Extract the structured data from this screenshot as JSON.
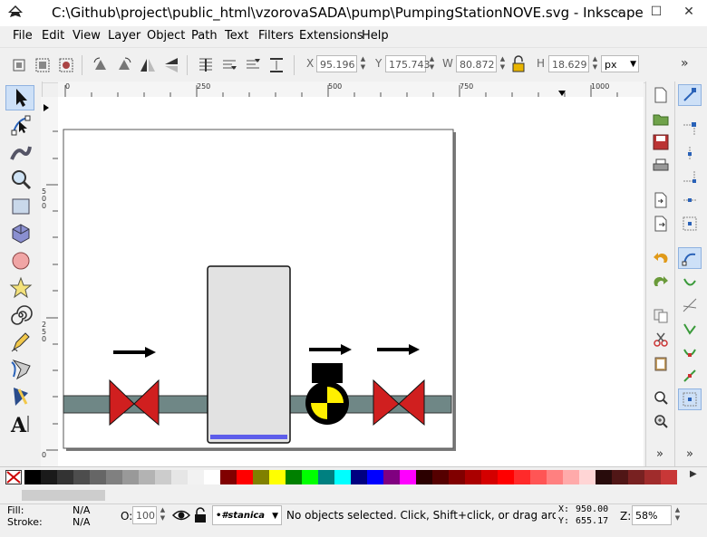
{
  "window": {
    "title": "C:\\Github\\project\\public_html\\vzorovaSADA\\pump\\PumpingStationNOVE.svg - Inkscape",
    "minimize": "–",
    "maximize": "☐",
    "close": "✕"
  },
  "menu": [
    "File",
    "Edit",
    "View",
    "Layer",
    "Object",
    "Path",
    "Text",
    "Filters",
    "Extensions",
    "Help"
  ],
  "toolbar": {
    "x_label": "X",
    "x_value": "95.196",
    "y_label": "Y",
    "y_value": "175.743",
    "w_label": "W",
    "w_value": "80.872",
    "h_label": "H",
    "h_value": "18.629",
    "unit": "px",
    "overflow": "»"
  },
  "ruler": {
    "h_ticks": [
      "0",
      "250",
      "500",
      "750",
      "1000"
    ],
    "v_ticks": [
      "500",
      "250",
      "0"
    ]
  },
  "tools": [
    "selector-tool",
    "node-tool",
    "tweak-tool",
    "zoom-tool",
    "rect-tool",
    "3dbox-tool",
    "ellipse-tool",
    "star-tool",
    "spiral-tool",
    "pencil-tool",
    "pen-tool",
    "calligraphy-tool",
    "text-tool"
  ],
  "palette": [
    "#000000",
    "#1a1a1a",
    "#333333",
    "#4d4d4d",
    "#666666",
    "#808080",
    "#999999",
    "#b3b3b3",
    "#cccccc",
    "#e6e6e6",
    "#f2f2f2",
    "#ffffff",
    "#800000",
    "#ff0000",
    "#808000",
    "#ffff00",
    "#008000",
    "#00ff00",
    "#008080",
    "#00ffff",
    "#000080",
    "#0000ff",
    "#800080",
    "#ff00ff",
    "#2b0000",
    "#550000",
    "#800000",
    "#aa0000",
    "#d40000",
    "#ff0000",
    "#ff2a2a",
    "#ff5555",
    "#ff8080",
    "#ffaaaa",
    "#ffd5d5",
    "#280b0b",
    "#501616",
    "#782121",
    "#a02c2c",
    "#c83737",
    "#d35f5f"
  ],
  "status": {
    "fill_label": "Fill:",
    "fill_value": "N/A",
    "stroke_label": "Stroke:",
    "stroke_value": "N/A",
    "opacity_label": "O:",
    "opacity_value": "100",
    "layer": "•#stanica",
    "message": "No objects selected. Click, Shift+click, or drag around ob",
    "x_label": "X:",
    "x_coord": "950.00",
    "y_label": "Y:",
    "y_coord": "655.17",
    "zoom_label": "Z:",
    "zoom_value": "58%"
  },
  "colors": {
    "pipe": "#6f8786",
    "valve": "#d01f1f",
    "tank_fill": "#e2e2e2",
    "tank_level": "#5d5dea",
    "pump_yellow": "#ffef00"
  }
}
